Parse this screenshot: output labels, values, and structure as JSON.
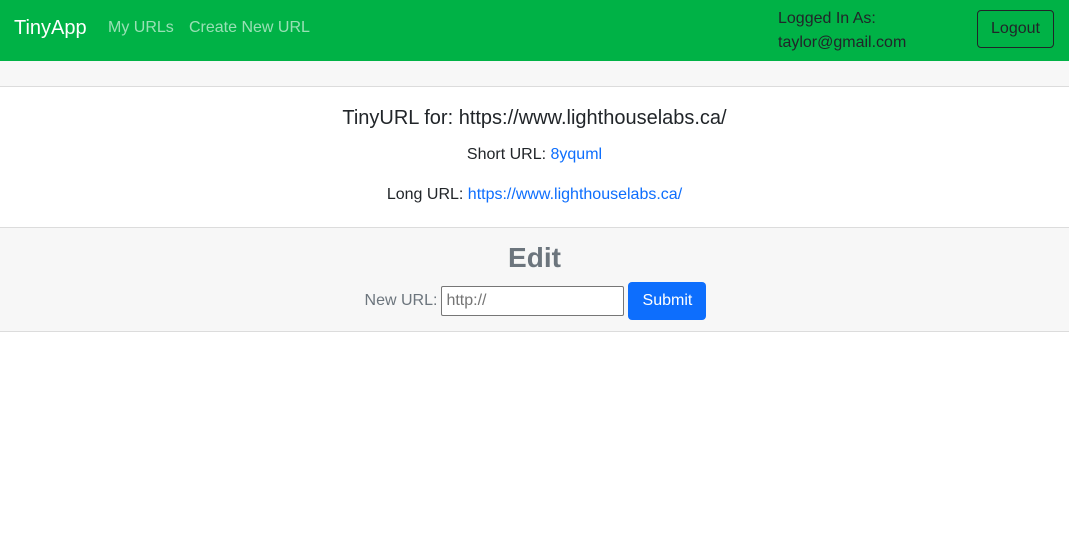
{
  "navbar": {
    "brand": "TinyApp",
    "links": [
      "My URLs",
      "Create New URL"
    ],
    "logged_in_label": "Logged In As:",
    "logged_in_email": "taylor@gmail.com",
    "logout_label": "Logout",
    "color": "#00b246"
  },
  "url_info": {
    "title": "TinyURL for: https://www.lighthouselabs.ca/",
    "short_label": "Short URL:",
    "short_value": "8yquml",
    "long_label": "Long URL:",
    "long_value": "https://www.lighthouselabs.ca/"
  },
  "edit": {
    "heading": "Edit",
    "new_url_label": "New URL:",
    "input_placeholder": "http://",
    "input_value": "",
    "submit_label": "Submit",
    "submit_color": "#0d6efd"
  }
}
